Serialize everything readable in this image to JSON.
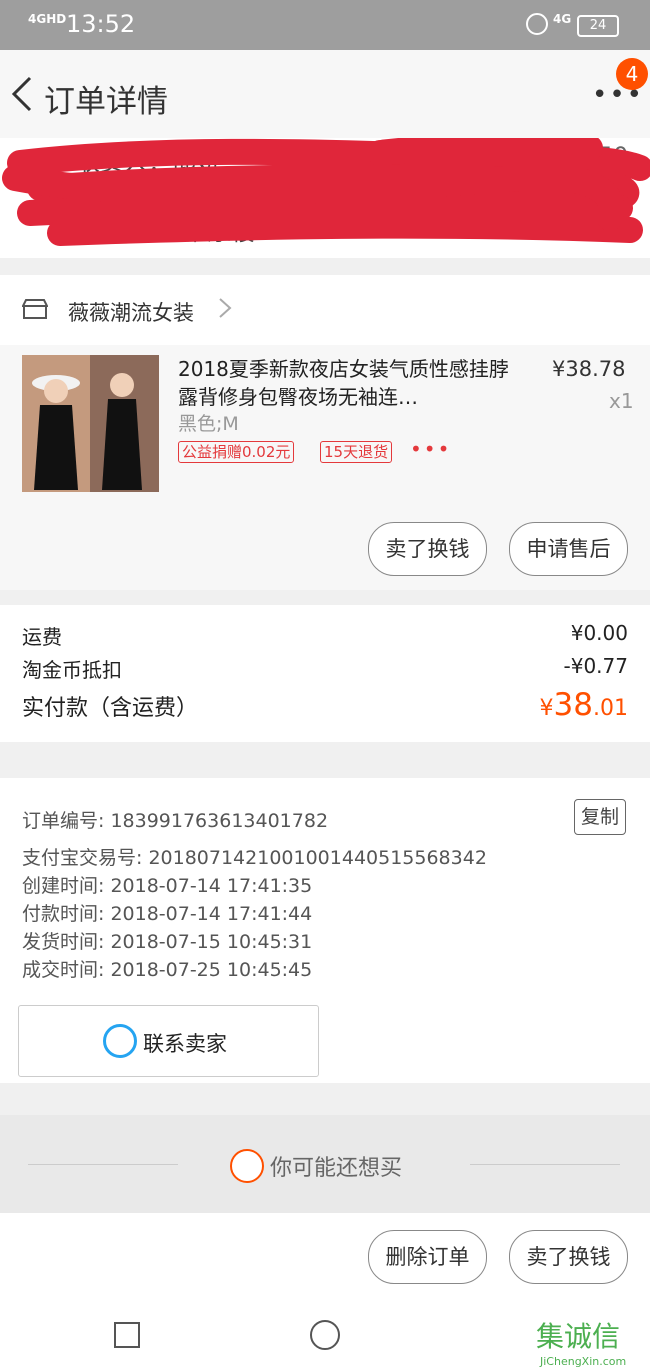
{
  "status_bar": {
    "network": "4GHD",
    "time": "13:52",
    "network2": "4G",
    "battery": "24"
  },
  "header": {
    "title": "订单详情",
    "badge": "4",
    "colors": {
      "accent": "#ff5000"
    }
  },
  "address": {
    "line1": "收货人：邱妍",
    "phone": "1978530 350",
    "line2": "广东省深圳市",
    "line3": "屏标 街道新 康楼"
  },
  "shop": {
    "name": "薇薇潮流女装"
  },
  "product": {
    "title": "2018夏季新款夜店女装气质性感挂脖露背修身包臀夜场无袖连…",
    "price": "¥38.78",
    "qty": "x1",
    "spec": "黑色;M",
    "tags": [
      "公益捐赠0.02元",
      "15天退货"
    ],
    "more": "•••",
    "buttons": [
      "卖了换钱",
      "申请售后"
    ]
  },
  "fees": {
    "shipping_label": "运费",
    "shipping_value": "¥0.00",
    "coin_label": "淘金币抵扣",
    "coin_value": "-¥0.77",
    "total_label": "实付款（含运费）",
    "total_symbol": "¥",
    "total_int": "38",
    "total_dec": ".01"
  },
  "info": {
    "copy_label": "复制",
    "rows": [
      "订单编号: 183991763613401782",
      "支付宝交易号: 2018071421001001440515568342",
      "创建时间: 2018-07-14 17:41:35",
      "付款时间: 2018-07-14 17:41:44",
      "发货时间: 2018-07-15 10:45:31",
      "成交时间: 2018-07-25 10:45:45"
    ],
    "contact_label": "联系卖家"
  },
  "recommend": {
    "label": "你可能还想买"
  },
  "bottom_actions": [
    "删除订单",
    "卖了换钱"
  ],
  "watermark": {
    "main": "集诚信",
    "sub": "JiChengXin.com"
  }
}
